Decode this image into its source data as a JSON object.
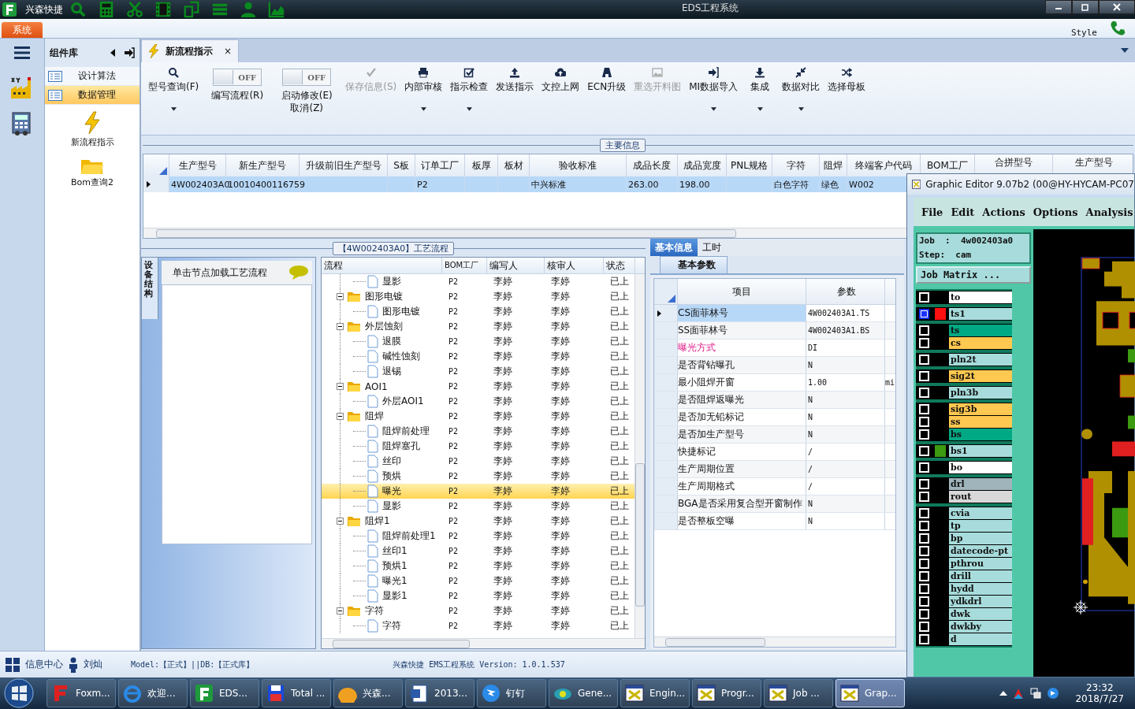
{
  "titlebar": {
    "app_name": "兴森快捷",
    "title": "EDS工程系统"
  },
  "ribbon": {
    "tab": "系统",
    "style": "Style"
  },
  "component_panel": {
    "title": "组件库",
    "items": [
      {
        "label": "设计算法",
        "selected": false
      },
      {
        "label": "数据管理",
        "selected": true
      }
    ],
    "tiles": [
      {
        "label": "新流程指示"
      },
      {
        "label": "Bom查询2"
      }
    ]
  },
  "doc_tab": {
    "label": "新流程指示",
    "close": "×"
  },
  "toolbar": [
    {
      "kind": "button",
      "label": "型号查询(F)",
      "disabled": false,
      "dropdown": true
    },
    {
      "kind": "toggle",
      "label": "编写流程(R)",
      "on": false,
      "state_text": "OFF"
    },
    {
      "kind": "toggle",
      "label": "启动修改(E)取消(Z)",
      "on": false,
      "state_text": "OFF"
    },
    {
      "kind": "button",
      "label": "保存信息(S)",
      "disabled": true,
      "dropdown": false
    },
    {
      "kind": "button",
      "label": "内部审核",
      "disabled": false,
      "dropdown": true
    },
    {
      "kind": "button",
      "label": "指示检查",
      "disabled": false,
      "dropdown": true
    },
    {
      "kind": "button",
      "label": "发送指示",
      "disabled": false,
      "dropdown": false
    },
    {
      "kind": "button",
      "label": "文控上网",
      "disabled": false,
      "dropdown": false
    },
    {
      "kind": "button",
      "label": "ECN升级",
      "disabled": false,
      "dropdown": false
    },
    {
      "kind": "button",
      "label": "重选开料图",
      "disabled": true,
      "dropdown": false
    },
    {
      "kind": "button",
      "label": "MI数据导入",
      "disabled": false,
      "dropdown": true
    },
    {
      "kind": "button",
      "label": "集成",
      "disabled": false,
      "dropdown": true
    },
    {
      "kind": "button",
      "label": "数据对比",
      "disabled": false,
      "dropdown": true
    },
    {
      "kind": "button",
      "label": "选择母板",
      "disabled": false,
      "dropdown": false
    }
  ],
  "main_info": {
    "title": "主要信息",
    "columns": [
      "生产型号",
      "新生产型号",
      "升级前旧生产型号",
      "S板",
      "订单工厂",
      "板厚",
      "板材",
      "验收标准",
      "成品长度",
      "成品宽度",
      "PNL规格",
      "字符",
      "阻焊",
      "终端客户代码",
      "BOM工厂",
      "合拼型号",
      "生产型号"
    ],
    "rows": [
      {
        "selected": true,
        "cells": [
          "4W002403A0",
          "10010400116759",
          "",
          "",
          "P2",
          "",
          "",
          "中兴标准",
          "263.00",
          "198.00",
          "",
          "白色字符",
          "绿色",
          "W002"
        ]
      }
    ]
  },
  "process": {
    "title": "【4W002403A0】工艺流程",
    "side_tab": "设备结构",
    "hint": "单击节点加载工艺流程",
    "columns": [
      "流程",
      "BOM工厂",
      "编写人",
      "核审人",
      "状态"
    ],
    "rows": [
      {
        "kind": "file",
        "label": "显影",
        "factory": "P2",
        "writer": "李婷",
        "reviewer": "李婷",
        "status": "已上",
        "selected": false
      },
      {
        "kind": "folder",
        "label": "图形电镀",
        "factory": "P2",
        "writer": "李婷",
        "reviewer": "李婷",
        "status": "已上",
        "selected": false,
        "children": [
          {
            "kind": "file",
            "label": "图形电镀",
            "factory": "P2",
            "writer": "李婷",
            "reviewer": "李婷",
            "status": "已上",
            "selected": false
          }
        ]
      },
      {
        "kind": "folder",
        "label": "外层蚀刻",
        "factory": "P2",
        "writer": "李婷",
        "reviewer": "李婷",
        "status": "已上",
        "selected": false,
        "children": [
          {
            "kind": "file",
            "label": "退膜",
            "factory": "P2",
            "writer": "李婷",
            "reviewer": "李婷",
            "status": "已上",
            "selected": false
          },
          {
            "kind": "file",
            "label": "碱性蚀刻",
            "factory": "P2",
            "writer": "李婷",
            "reviewer": "李婷",
            "status": "已上",
            "selected": false
          },
          {
            "kind": "file",
            "label": "退锡",
            "factory": "P2",
            "writer": "李婷",
            "reviewer": "李婷",
            "status": "已上",
            "selected": false
          }
        ]
      },
      {
        "kind": "folder",
        "label": "AOI1",
        "factory": "P2",
        "writer": "李婷",
        "reviewer": "李婷",
        "status": "已上",
        "selected": false,
        "children": [
          {
            "kind": "file",
            "label": "外层AOI1",
            "factory": "P2",
            "writer": "李婷",
            "reviewer": "李婷",
            "status": "已上",
            "selected": false
          }
        ]
      },
      {
        "kind": "folder",
        "label": "阻焊",
        "factory": "P2",
        "writer": "李婷",
        "reviewer": "李婷",
        "status": "已上",
        "selected": false,
        "children": [
          {
            "kind": "file",
            "label": "阻焊前处理",
            "factory": "P2",
            "writer": "李婷",
            "reviewer": "李婷",
            "status": "已上",
            "selected": false
          },
          {
            "kind": "file",
            "label": "阻焊塞孔",
            "factory": "P2",
            "writer": "李婷",
            "reviewer": "李婷",
            "status": "已上",
            "selected": false
          },
          {
            "kind": "file",
            "label": "丝印",
            "factory": "P2",
            "writer": "李婷",
            "reviewer": "李婷",
            "status": "已上",
            "selected": false
          },
          {
            "kind": "file",
            "label": "预烘",
            "factory": "P2",
            "writer": "李婷",
            "reviewer": "李婷",
            "status": "已上",
            "selected": false
          },
          {
            "kind": "file",
            "label": "曝光",
            "factory": "P2",
            "writer": "李婷",
            "reviewer": "李婷",
            "status": "已上",
            "selected": true
          },
          {
            "kind": "file",
            "label": "显影",
            "factory": "P2",
            "writer": "李婷",
            "reviewer": "李婷",
            "status": "已上",
            "selected": false
          }
        ]
      },
      {
        "kind": "folder",
        "label": "阻焊1",
        "factory": "P2",
        "writer": "李婷",
        "reviewer": "李婷",
        "status": "已上",
        "selected": false,
        "children": [
          {
            "kind": "file",
            "label": "阻焊前处理1",
            "factory": "P2",
            "writer": "李婷",
            "reviewer": "李婷",
            "status": "已上",
            "selected": false
          },
          {
            "kind": "file",
            "label": "丝印1",
            "factory": "P2",
            "writer": "李婷",
            "reviewer": "李婷",
            "status": "已上",
            "selected": false
          },
          {
            "kind": "file",
            "label": "预烘1",
            "factory": "P2",
            "writer": "李婷",
            "reviewer": "李婷",
            "status": "已上",
            "selected": false
          },
          {
            "kind": "file",
            "label": "曝光1",
            "factory": "P2",
            "writer": "李婷",
            "reviewer": "李婷",
            "status": "已上",
            "selected": false
          },
          {
            "kind": "file",
            "label": "显影1",
            "factory": "P2",
            "writer": "李婷",
            "reviewer": "李婷",
            "status": "已上",
            "selected": false
          }
        ]
      },
      {
        "kind": "folder",
        "label": "字符",
        "factory": "P2",
        "writer": "李婷",
        "reviewer": "李婷",
        "status": "已上",
        "selected": false,
        "children": [
          {
            "kind": "file",
            "label": "字符",
            "factory": "P2",
            "writer": "李婷",
            "reviewer": "李婷",
            "status": "已上",
            "selected": false
          }
        ]
      }
    ]
  },
  "basic_info": {
    "tabs": [
      {
        "label": "基本信息",
        "selected": true
      },
      {
        "label": "工时",
        "selected": false
      }
    ],
    "sub_tab": "基本参数",
    "columns": [
      "项目",
      "参数"
    ],
    "rows": [
      {
        "item": "CS面菲林号",
        "value": "4W002403A1.TS",
        "highlighted": false,
        "selected": true
      },
      {
        "item": "SS面菲林号",
        "value": "4W002403A1.BS",
        "highlighted": false,
        "selected": false
      },
      {
        "item": "曝光方式",
        "value": "DI",
        "highlighted": true,
        "selected": false
      },
      {
        "item": "是否背钻曝孔",
        "value": "N",
        "highlighted": false,
        "selected": false
      },
      {
        "item": "最小阻焊开窗",
        "value": "1.00",
        "unit": "mi",
        "highlighted": false,
        "selected": false
      },
      {
        "item": "是否阻焊返曝光",
        "value": "N",
        "highlighted": false,
        "selected": false
      },
      {
        "item": "是否加无铅标记",
        "value": "N",
        "highlighted": false,
        "selected": false
      },
      {
        "item": "是否加生产型号",
        "value": "N",
        "highlighted": false,
        "selected": false
      },
      {
        "item": "快捷标记",
        "value": "/",
        "highlighted": false,
        "selected": false
      },
      {
        "item": "生产周期位置",
        "value": "/",
        "highlighted": false,
        "selected": false
      },
      {
        "item": "生产周期格式",
        "value": "/",
        "highlighted": false,
        "selected": false
      },
      {
        "item": "BGA是否采用复合型开窗制作",
        "value": "N",
        "highlighted": false,
        "selected": false
      },
      {
        "item": "是否整板空曝",
        "value": "N",
        "highlighted": false,
        "selected": false
      }
    ]
  },
  "graphic_editor": {
    "title": "Graphic Editor 9.07b2 (00@HY-HYCAM-PC07",
    "menu": [
      "File",
      "Edit",
      "Actions",
      "Options",
      "Analysis"
    ],
    "job": "Job  :  4w002403a0",
    "step": "Step:  cam",
    "matrix_button": "Job Matrix ...",
    "layer_groups": [
      [
        {
          "name": "to",
          "color": "#ffffff",
          "selected": false
        }
      ],
      [
        {
          "name": "ts1",
          "color": "#a8dcdc",
          "swatch": {
            "color": "#ff1010"
          },
          "selected": true
        }
      ],
      [
        {
          "name": "ts",
          "color": "#00a884",
          "selected": false
        },
        {
          "name": "cs",
          "color": "#ffc850",
          "selected": false
        }
      ],
      [
        {
          "name": "pln2t",
          "color": "#a8dcdc",
          "selected": false
        }
      ],
      [
        {
          "name": "sig2t",
          "color": "#ffc850",
          "selected": false
        }
      ],
      [
        {
          "name": "pln3b",
          "color": "#a8dcdc",
          "selected": false
        }
      ],
      [
        {
          "name": "sig3b",
          "color": "#ffc850",
          "selected": false
        },
        {
          "name": "ss",
          "color": "#ffc850",
          "selected": false
        },
        {
          "name": "bs",
          "color": "#00a884",
          "selected": false
        }
      ],
      [
        {
          "name": "bs1",
          "color": "#a8dcdc",
          "swatch": {
            "color": "#3c9a10"
          },
          "selected": false
        }
      ],
      [
        {
          "name": "bo",
          "color": "#ffffff",
          "selected": false
        }
      ],
      [
        {
          "name": "drl",
          "color": "#a0b4bc",
          "selected": false
        },
        {
          "name": "rout",
          "color": "#d8d8d8",
          "selected": false
        }
      ],
      [
        {
          "name": "cvia",
          "color": "#a8dcdc",
          "selected": false
        },
        {
          "name": "tp",
          "color": "#a8dcdc",
          "selected": false
        },
        {
          "name": "bp",
          "color": "#a8dcdc",
          "selected": false
        },
        {
          "name": "datecode-pt",
          "color": "#a8dcdc",
          "selected": false
        },
        {
          "name": "pthrou",
          "color": "#a8dcdc",
          "selected": false
        },
        {
          "name": "drill",
          "color": "#a8dcdc",
          "selected": false
        },
        {
          "name": "hydd",
          "color": "#a8dcdc",
          "selected": false
        },
        {
          "name": "ydkdrl",
          "color": "#a8dcdc",
          "selected": false
        },
        {
          "name": "dwk",
          "color": "#a8dcdc",
          "selected": false
        },
        {
          "name": "dwkby",
          "color": "#a8dcdc",
          "selected": false
        },
        {
          "name": "d",
          "color": "#a8dcdc",
          "selected": false
        }
      ]
    ]
  },
  "status_bar": {
    "info_center": "信息中心",
    "user": "刘灿",
    "model": "Model:【正式】||DB:【正式库】",
    "version": "兴森快捷 EMS工程系统 Version: 1.0.1.537"
  },
  "taskbar": {
    "items": [
      {
        "label": "Foxm...",
        "selected": false
      },
      {
        "label": "欢迎...",
        "selected": false
      },
      {
        "label": "EDS...",
        "selected": false
      },
      {
        "label": "Total ...",
        "selected": false
      },
      {
        "label": "兴森...",
        "selected": false
      },
      {
        "label": "2013...",
        "selected": false
      },
      {
        "label": "钉钉",
        "selected": false
      },
      {
        "label": "Gene...",
        "selected": false
      },
      {
        "label": "Engin...",
        "selected": false
      },
      {
        "label": "Progr...",
        "selected": false
      },
      {
        "label": "Job ...",
        "selected": false
      },
      {
        "label": "Grap...",
        "selected": true
      }
    ],
    "time": "23:32",
    "date": "2018/7/27"
  }
}
